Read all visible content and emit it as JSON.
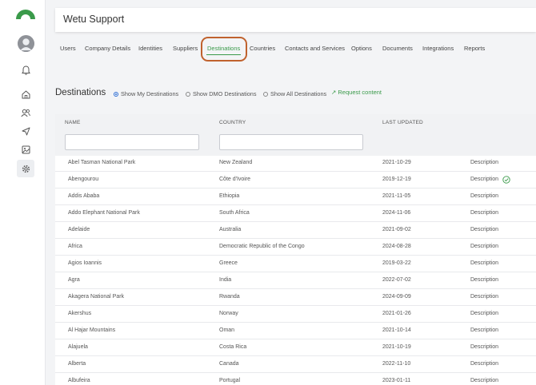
{
  "app": {
    "title": "Wetu Support",
    "brand_color": "#3a9a4a",
    "ring_color": "#c0622e"
  },
  "rail": {
    "icons": [
      "logo-arc-icon",
      "avatar",
      "bell-icon",
      "home-icon",
      "users-icon",
      "send-icon",
      "image-icon",
      "gear-icon"
    ]
  },
  "tabs": [
    {
      "label": "Users"
    },
    {
      "label": "Company Details"
    },
    {
      "label": "Identities"
    },
    {
      "label": "Suppliers"
    },
    {
      "label": "Destinations",
      "active": true
    },
    {
      "label": "Countries"
    },
    {
      "label": "Contacts and Services"
    },
    {
      "label": "Options"
    },
    {
      "label": "Documents"
    },
    {
      "label": "Integrations"
    },
    {
      "label": "Reports"
    }
  ],
  "section": {
    "title": "Destinations",
    "filters": [
      {
        "label": "Show My Destinations",
        "selected": true
      },
      {
        "label": "Show DMO Destinations",
        "selected": false
      },
      {
        "label": "Show All Destinations",
        "selected": false
      }
    ],
    "request_label": "Request content"
  },
  "table": {
    "columns": [
      "NAME",
      "COUNTRY",
      "LAST UPDATED"
    ],
    "name_filter_value": "",
    "country_filter_value": "",
    "rows": [
      {
        "name": "Abel Tasman National Park",
        "country": "New Zealand",
        "updated": "2021-10-29",
        "action": "Description",
        "verified": false
      },
      {
        "name": "Abengourou",
        "country": "Côte d'Ivoire",
        "updated": "2019-12-19",
        "action": "Description",
        "verified": true
      },
      {
        "name": "Addis Ababa",
        "country": "Ethiopia",
        "updated": "2021-11-05",
        "action": "Description",
        "verified": false
      },
      {
        "name": "Addo Elephant National Park",
        "country": "South Africa",
        "updated": "2024-11-06",
        "action": "Description",
        "verified": false
      },
      {
        "name": "Adelaide",
        "country": "Australia",
        "updated": "2021-09-02",
        "action": "Description",
        "verified": false
      },
      {
        "name": "Africa",
        "country": "Democratic Republic of the Congo",
        "updated": "2024-08-28",
        "action": "Description",
        "verified": false
      },
      {
        "name": "Agios Ioannis",
        "country": "Greece",
        "updated": "2019-03-22",
        "action": "Description",
        "verified": false
      },
      {
        "name": "Agra",
        "country": "India",
        "updated": "2022-07-02",
        "action": "Description",
        "verified": false
      },
      {
        "name": "Akagera National Park",
        "country": "Rwanda",
        "updated": "2024-09-09",
        "action": "Description",
        "verified": false
      },
      {
        "name": "Akershus",
        "country": "Norway",
        "updated": "2021-01-26",
        "action": "Description",
        "verified": false
      },
      {
        "name": "Al Hajar Mountains",
        "country": "Oman",
        "updated": "2021-10-14",
        "action": "Description",
        "verified": false
      },
      {
        "name": "Alajuela",
        "country": "Costa Rica",
        "updated": "2021-10-19",
        "action": "Description",
        "verified": false
      },
      {
        "name": "Alberta",
        "country": "Canada",
        "updated": "2022-11-10",
        "action": "Description",
        "verified": false
      },
      {
        "name": "Albufeira",
        "country": "Portugal",
        "updated": "2023-01-11",
        "action": "Description",
        "verified": false
      }
    ]
  }
}
